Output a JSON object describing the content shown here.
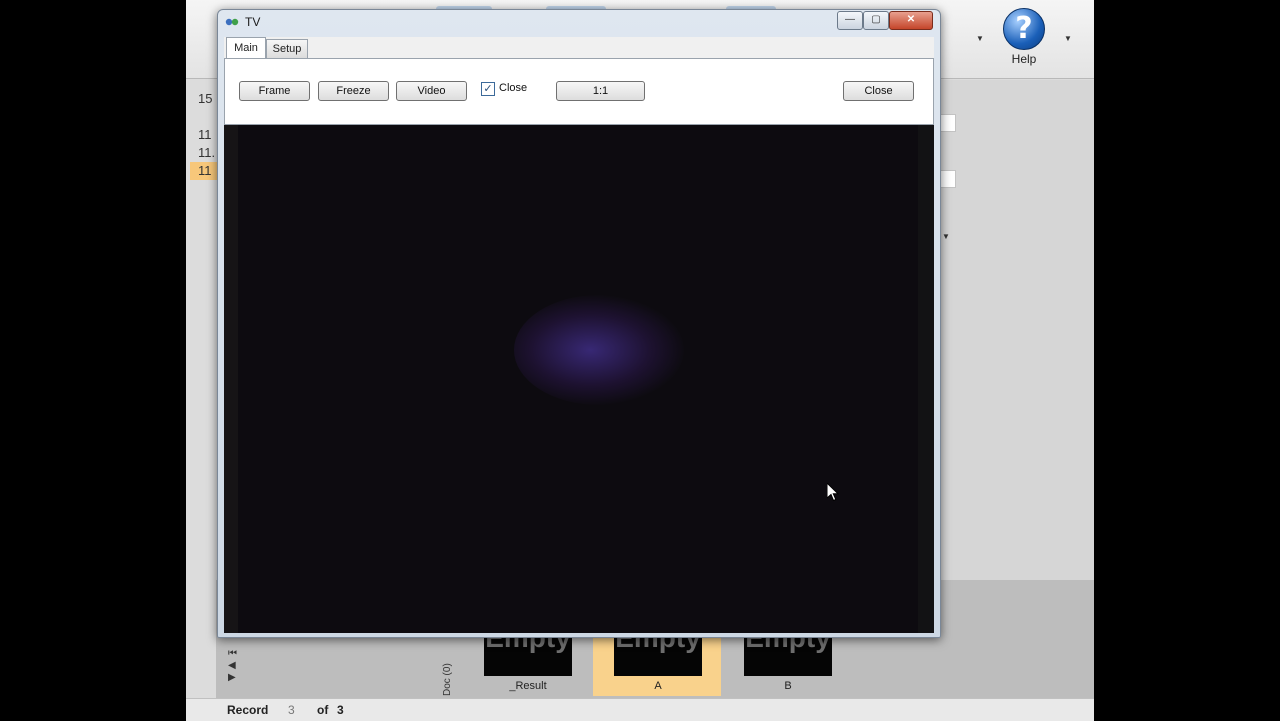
{
  "app": {
    "help_label": "Help",
    "left_rows": [
      "15",
      "11",
      "11.",
      "11"
    ],
    "thumbnails": [
      {
        "image_text": "Empty",
        "caption": "_Result"
      },
      {
        "image_text": "Empty",
        "caption": "A"
      },
      {
        "image_text": "Empty",
        "caption": "B"
      }
    ],
    "doc_label": "Doc (0)",
    "nav_arrows": [
      "⏮",
      "◀",
      "▶"
    ],
    "status": {
      "record_label": "Record",
      "record_current": "3",
      "of_label": "of",
      "record_total": "3"
    }
  },
  "tv_window": {
    "title": "TV",
    "title_buttons": {
      "minimize": "—",
      "maximize": "▢",
      "close": "✕"
    },
    "tabs": [
      {
        "label": "Main",
        "active": true
      },
      {
        "label": "Setup",
        "active": false
      }
    ],
    "buttons": {
      "frame": "Frame",
      "freeze": "Freeze",
      "video": "Video",
      "ratio": "1:1",
      "close": "Close"
    },
    "close_checkbox": {
      "label": "Close",
      "checked": true,
      "mark": "✓"
    }
  }
}
